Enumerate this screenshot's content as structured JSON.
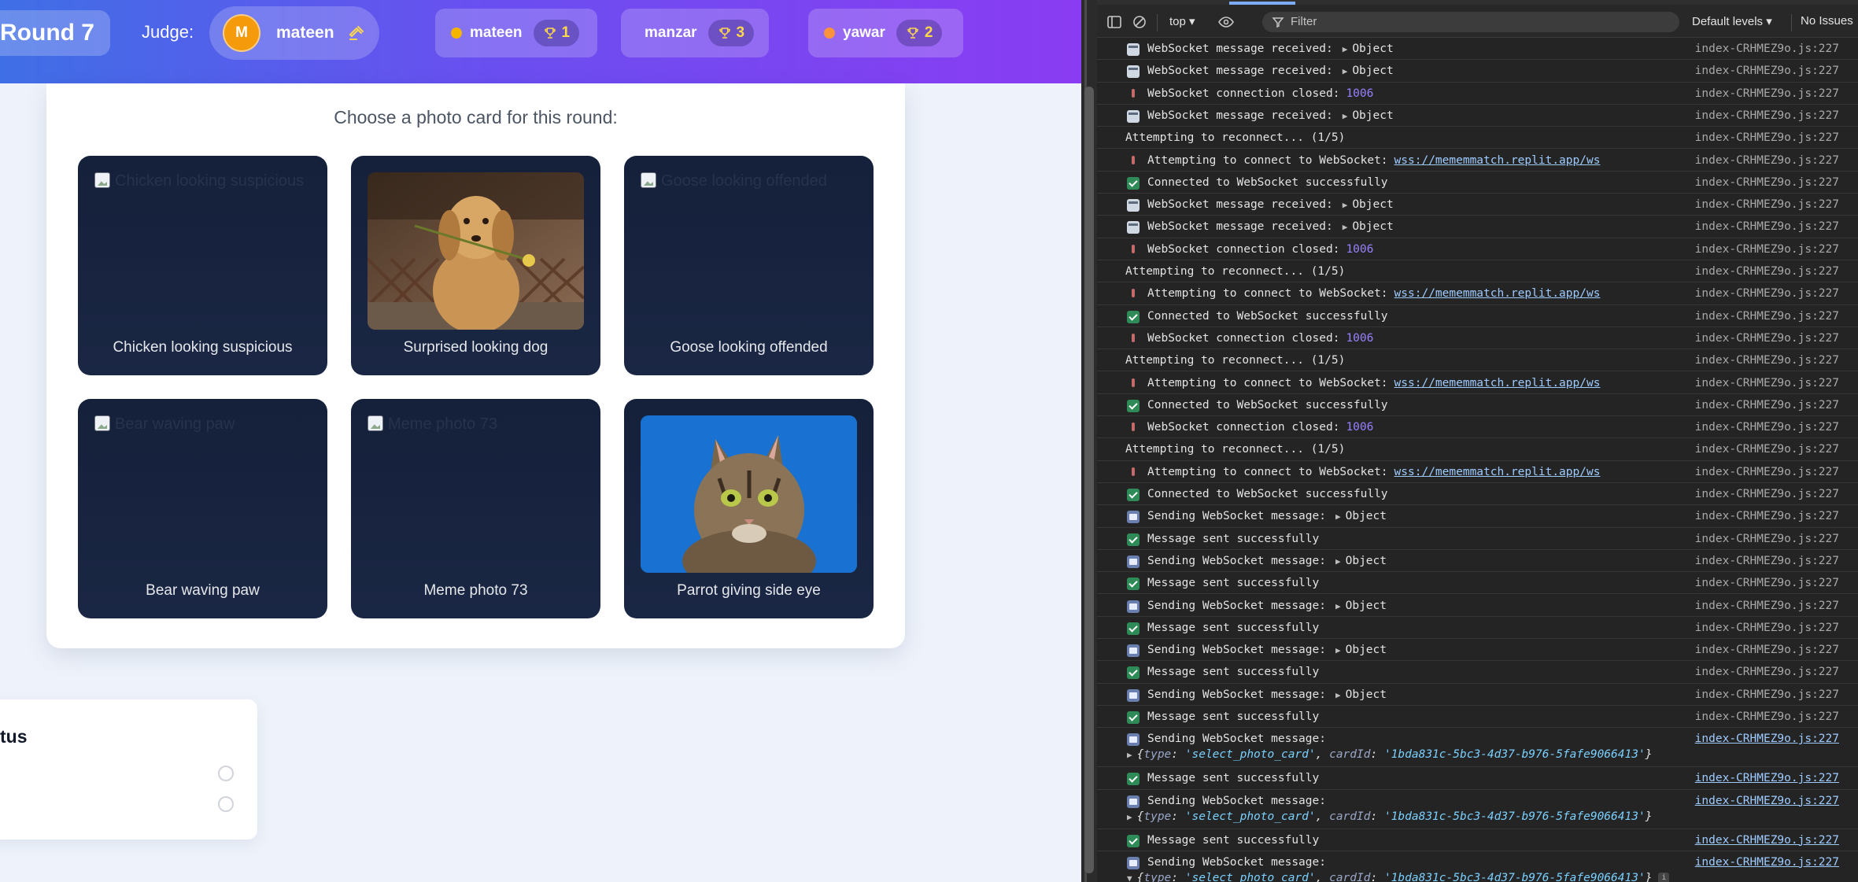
{
  "header": {
    "round_label": "Round 7",
    "judge_label": "Judge:",
    "judge": {
      "initial": "M",
      "name": "mateen"
    },
    "players": [
      {
        "name": "mateen",
        "score": "1",
        "dot_color": "#f5b400"
      },
      {
        "name": "manzar",
        "score": "3",
        "dot_color": "#d1d5db"
      },
      {
        "name": "yawar",
        "score": "2",
        "dot_color": "#fb923c"
      }
    ]
  },
  "panel": {
    "title": "Choose a photo card for this round:",
    "cards": [
      {
        "caption": "Chicken looking suspicious",
        "alt": "Chicken looking suspicious",
        "image": "broken"
      },
      {
        "caption": "Surprised looking dog",
        "alt": "Surprised looking dog",
        "image": "dog"
      },
      {
        "caption": "Goose looking offended",
        "alt": "Goose looking offended",
        "image": "broken"
      },
      {
        "caption": "Bear waving paw",
        "alt": "Bear waving paw",
        "image": "broken"
      },
      {
        "caption": "Meme photo 73",
        "alt": "Meme photo 73",
        "image": "broken"
      },
      {
        "caption": "Parrot giving side eye",
        "alt": "Parrot giving side eye",
        "image": "cat"
      }
    ]
  },
  "status_card": {
    "title": "tus"
  },
  "devtools": {
    "context": "top",
    "filter_placeholder": "Filter",
    "levels": "Default levels",
    "issues": "No Issues",
    "logs": [
      {
        "icon": "ws",
        "text": "WebSocket message received:",
        "obj": "Object",
        "src": "index-CRHMEZ9o.js:227"
      },
      {
        "icon": "ws",
        "text": "WebSocket message received:",
        "obj": "Object",
        "src": "index-CRHMEZ9o.js:227"
      },
      {
        "icon": "pin",
        "text": "WebSocket connection closed:",
        "num": "1006",
        "src": "index-CRHMEZ9o.js:227"
      },
      {
        "icon": "ws",
        "text": "WebSocket message received:",
        "obj": "Object",
        "src": "index-CRHMEZ9o.js:227"
      },
      {
        "icon": "none",
        "text": "Attempting to reconnect... (1/5)",
        "src": "index-CRHMEZ9o.js:227"
      },
      {
        "icon": "pin",
        "text": "Attempting to connect to WebSocket:",
        "url": "wss://mememmatch.replit.app/ws",
        "src": "index-CRHMEZ9o.js:227"
      },
      {
        "icon": "ok",
        "text": "Connected to WebSocket successfully",
        "src": "index-CRHMEZ9o.js:227"
      },
      {
        "icon": "ws",
        "text": "WebSocket message received:",
        "obj": "Object",
        "src": "index-CRHMEZ9o.js:227"
      },
      {
        "icon": "ws",
        "text": "WebSocket message received:",
        "obj": "Object",
        "src": "index-CRHMEZ9o.js:227"
      },
      {
        "icon": "pin",
        "text": "WebSocket connection closed:",
        "num": "1006",
        "src": "index-CRHMEZ9o.js:227"
      },
      {
        "icon": "none",
        "text": "Attempting to reconnect... (1/5)",
        "src": "index-CRHMEZ9o.js:227"
      },
      {
        "icon": "pin",
        "text": "Attempting to connect to WebSocket:",
        "url": "wss://mememmatch.replit.app/ws",
        "src": "index-CRHMEZ9o.js:227"
      },
      {
        "icon": "ok",
        "text": "Connected to WebSocket successfully",
        "src": "index-CRHMEZ9o.js:227"
      },
      {
        "icon": "pin",
        "text": "WebSocket connection closed:",
        "num": "1006",
        "src": "index-CRHMEZ9o.js:227"
      },
      {
        "icon": "none",
        "text": "Attempting to reconnect... (1/5)",
        "src": "index-CRHMEZ9o.js:227"
      },
      {
        "icon": "pin",
        "text": "Attempting to connect to WebSocket:",
        "url": "wss://mememmatch.replit.app/ws",
        "src": "index-CRHMEZ9o.js:227"
      },
      {
        "icon": "ok",
        "text": "Connected to WebSocket successfully",
        "src": "index-CRHMEZ9o.js:227"
      },
      {
        "icon": "pin",
        "text": "WebSocket connection closed:",
        "num": "1006",
        "src": "index-CRHMEZ9o.js:227"
      },
      {
        "icon": "none",
        "text": "Attempting to reconnect... (1/5)",
        "src": "index-CRHMEZ9o.js:227"
      },
      {
        "icon": "pin",
        "text": "Attempting to connect to WebSocket:",
        "url": "wss://mememmatch.replit.app/ws",
        "src": "index-CRHMEZ9o.js:227"
      },
      {
        "icon": "ok",
        "text": "Connected to WebSocket successfully",
        "src": "index-CRHMEZ9o.js:227"
      },
      {
        "icon": "send",
        "text": "Sending WebSocket message:",
        "obj": "Object",
        "src": "index-CRHMEZ9o.js:227"
      },
      {
        "icon": "ok",
        "text": "Message sent successfully",
        "src": "index-CRHMEZ9o.js:227"
      },
      {
        "icon": "send",
        "text": "Sending WebSocket message:",
        "obj": "Object",
        "src": "index-CRHMEZ9o.js:227"
      },
      {
        "icon": "ok",
        "text": "Message sent successfully",
        "src": "index-CRHMEZ9o.js:227"
      },
      {
        "icon": "send",
        "text": "Sending WebSocket message:",
        "obj": "Object",
        "src": "index-CRHMEZ9o.js:227"
      },
      {
        "icon": "ok",
        "text": "Message sent successfully",
        "src": "index-CRHMEZ9o.js:227"
      },
      {
        "icon": "send",
        "text": "Sending WebSocket message:",
        "obj": "Object",
        "src": "index-CRHMEZ9o.js:227"
      },
      {
        "icon": "ok",
        "text": "Message sent successfully",
        "src": "index-CRHMEZ9o.js:227"
      },
      {
        "icon": "send",
        "text": "Sending WebSocket message:",
        "obj": "Object",
        "src": "index-CRHMEZ9o.js:227"
      },
      {
        "icon": "ok",
        "text": "Message sent successfully",
        "src": "index-CRHMEZ9o.js:227"
      },
      {
        "icon": "send",
        "text": "Sending WebSocket message:",
        "payload": {
          "type": "'select_photo_card'",
          "cardId": "'1bda831c-5bc3-4d37-b976-5fafe9066413'"
        },
        "src": "index-CRHMEZ9o.js:227",
        "link": true
      },
      {
        "icon": "ok",
        "text": "Message sent successfully",
        "src": "index-CRHMEZ9o.js:227",
        "link": true
      },
      {
        "icon": "send",
        "text": "Sending WebSocket message:",
        "payload": {
          "type": "'select_photo_card'",
          "cardId": "'1bda831c-5bc3-4d37-b976-5fafe9066413'"
        },
        "src": "index-CRHMEZ9o.js:227",
        "link": true
      },
      {
        "icon": "ok",
        "text": "Message sent successfully",
        "src": "index-CRHMEZ9o.js:227",
        "link": true
      },
      {
        "icon": "send",
        "text": "Sending WebSocket message:",
        "payload": {
          "type": "'select_photo_card'",
          "cardId": "'1bda831c-5bc3-4d37-b976-5fafe9066413'"
        },
        "expanded": true,
        "src": "index-CRHMEZ9o.js:227",
        "link": true
      }
    ]
  }
}
